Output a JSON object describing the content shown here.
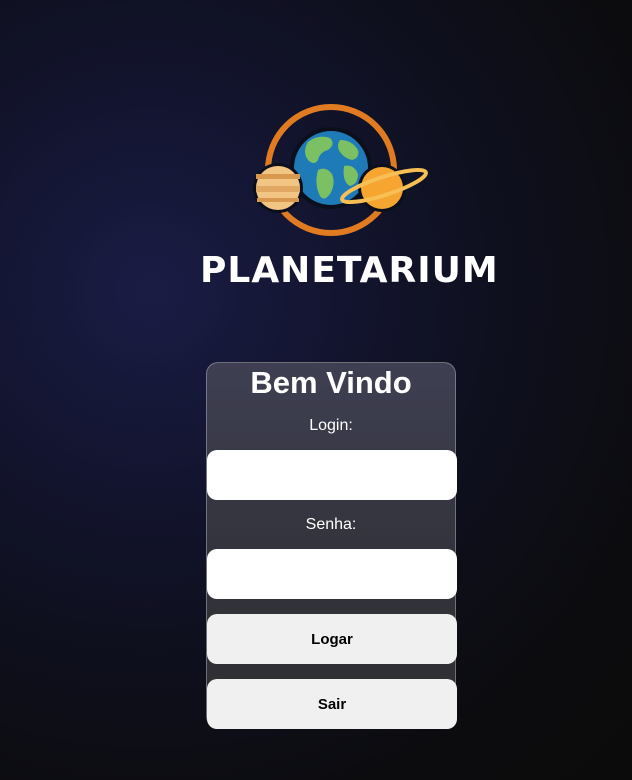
{
  "brand": {
    "name": "PLANETARIUM",
    "logo_icon": "planets-orbit-logo",
    "colors": {
      "orbit": "#e07b22",
      "ocean": "#1f7ab8",
      "land": "#7bc062",
      "jupiter": "#f2c585",
      "saturn": "#f6a530"
    }
  },
  "login_card": {
    "title": "Bem Vindo",
    "login_label": "Login:",
    "login_value": "",
    "password_label": "Senha:",
    "password_value": "",
    "submit_label": "Logar",
    "exit_label": "Sair"
  }
}
